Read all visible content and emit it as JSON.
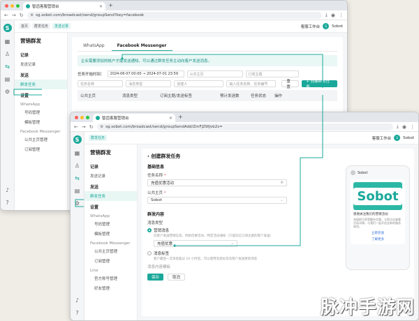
{
  "browser": {
    "tab_title": "智齿客服营销台",
    "url1": "sg.sobot.com/broadcast/send/groupSend?key=facebook",
    "url2": "sg.sobot.com/broadcast/send/groupSendAdd/ZmFjZWJvb2s="
  },
  "header": {
    "crumbs": [
      "首页",
      "群发任务",
      "发送记录"
    ],
    "workbench": "客服工作台",
    "user": "Sobot"
  },
  "sidebar": {
    "title": "营销群发",
    "groups": [
      {
        "label": "记录",
        "items": [
          "发送记录"
        ]
      },
      {
        "label": "发送",
        "items": [
          "群发任务"
        ]
      },
      {
        "label": "设置",
        "items": []
      }
    ],
    "channels": [
      {
        "label": "WhatsApp",
        "items": [
          "号码管理",
          "模板管理"
        ]
      },
      {
        "label": "Facebook Messenger",
        "items": [
          "公共主页管理",
          "订阅管理"
        ]
      },
      {
        "label": "Line",
        "items": [
          "官方账号管理",
          "好友管理"
        ]
      }
    ]
  },
  "list_page": {
    "tabs": [
      "WhatsApp",
      "Facebook Messenger"
    ],
    "notice": "企业需要添加的帐户才能发送通知，可以通过群发任务主动向客户发送消息。",
    "filters": {
      "time_label": "任务开始时间：",
      "time_from": "2024-06-07 00:00",
      "time_to": "2024-07-01 23:59",
      "page_placeholder": "公共主页",
      "status_placeholder": "订阅主题",
      "task_placeholder": "任务名称",
      "type_placeholder": "消息类型",
      "creator_placeholder": "创建人",
      "search_placeholder": "输入任务名称、任务编号"
    },
    "reset_button": "重置",
    "create_button": "+ 创建群发任务",
    "columns": [
      "公共主页",
      "消息类型",
      "订阅主题/发送标签",
      "预计发送数",
      "任务状态",
      "操作"
    ]
  },
  "create_page": {
    "title": "创建群发任务",
    "section_basic": "基础信息",
    "task_name_label": "任务名称",
    "task_name_value": "充值优惠活动",
    "page_label": "公共主页",
    "page_value": "Sobot",
    "section_content": "群发内容",
    "msg_type_label": "消息类型",
    "option1_title": "营销消息",
    "option1_desc": "向客户发送营销信息，例如优惠活动、特定活动通知（只能向已订阅主题的客户发送）",
    "topic_value": "充值优惠",
    "option2_title": "消息标签",
    "option2_desc": "客户最后一次消息超过 24 小时后，可以使用消息标签向客户发送更新消息",
    "content_label": "消息内容模板",
    "save_button": "保存",
    "cancel_button": "取消"
  },
  "preview": {
    "sender": "Sobot",
    "banner_word": "Sobot",
    "card_title": "感谢关注我们的营销活动",
    "card_desc": "充值即可享受额外优惠，立即点击查看活动详情，与我们一起开启全新的服务体验。",
    "link1": "立即充值",
    "link2": "了解更多"
  },
  "watermark": "脉冲手游网",
  "colors": {
    "accent": "#1aa89a",
    "notice_bg": "#e9f7f5"
  }
}
